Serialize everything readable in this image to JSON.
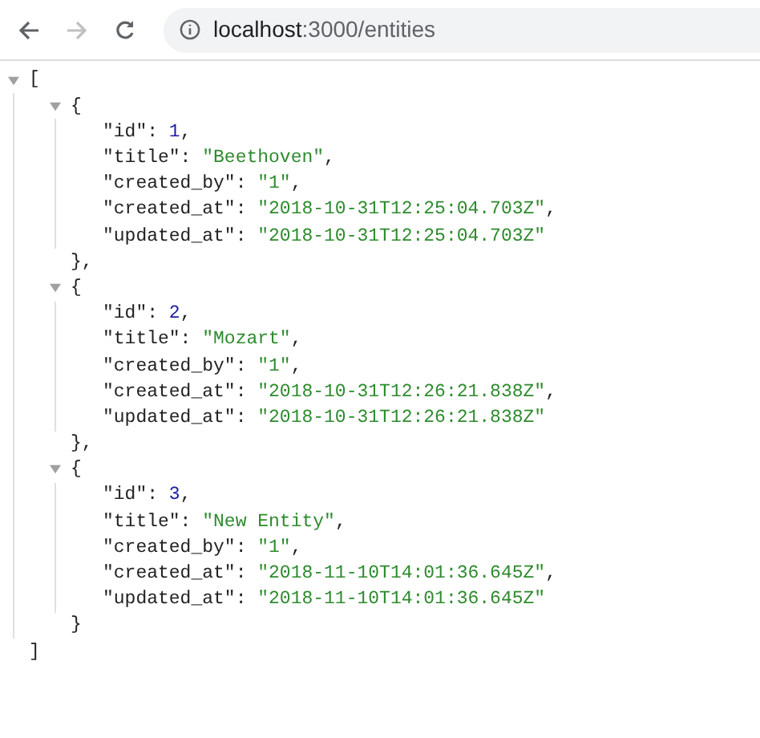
{
  "toolbar": {
    "back_disabled": false,
    "forward_disabled": true,
    "url_host": "localhost",
    "url_rest": ":3000/entities"
  },
  "viewer": {
    "open": "[",
    "close": "]",
    "expanded": true,
    "items": [
      {
        "open": "{",
        "close": "},",
        "expanded": true,
        "fields": [
          {
            "key": "\"id\":",
            "value": "1",
            "kind": "number",
            "end": ","
          },
          {
            "key": "\"title\":",
            "value": "\"Beethoven\"",
            "kind": "string",
            "end": ","
          },
          {
            "key": "\"created_by\":",
            "value": "\"1\"",
            "kind": "string",
            "end": ","
          },
          {
            "key": "\"created_at\":",
            "value": "\"2018-10-31T12:25:04.703Z\"",
            "kind": "string",
            "end": ","
          },
          {
            "key": "\"updated_at\":",
            "value": "\"2018-10-31T12:25:04.703Z\"",
            "kind": "string"
          }
        ]
      },
      {
        "open": "{",
        "close": "},",
        "expanded": true,
        "fields": [
          {
            "key": "\"id\":",
            "value": "2",
            "kind": "number",
            "end": ","
          },
          {
            "key": "\"title\":",
            "value": "\"Mozart\"",
            "kind": "string",
            "end": ","
          },
          {
            "key": "\"created_by\":",
            "value": "\"1\"",
            "kind": "string",
            "end": ","
          },
          {
            "key": "\"created_at\":",
            "value": "\"2018-10-31T12:26:21.838Z\"",
            "kind": "string",
            "end": ","
          },
          {
            "key": "\"updated_at\":",
            "value": "\"2018-10-31T12:26:21.838Z\"",
            "kind": "string"
          }
        ]
      },
      {
        "open": "{",
        "close": "}",
        "expanded": true,
        "fields": [
          {
            "key": "\"id\":",
            "value": "3",
            "kind": "number",
            "end": ","
          },
          {
            "key": "\"title\":",
            "value": "\"New Entity\"",
            "kind": "string",
            "end": ","
          },
          {
            "key": "\"created_by\":",
            "value": "\"1\"",
            "kind": "string",
            "end": ","
          },
          {
            "key": "\"created_at\":",
            "value": "\"2018-11-10T14:01:36.645Z\"",
            "kind": "string",
            "end": ","
          },
          {
            "key": "\"updated_at\":",
            "value": "\"2018-11-10T14:01:36.645Z\"",
            "kind": "string"
          }
        ]
      }
    ]
  }
}
